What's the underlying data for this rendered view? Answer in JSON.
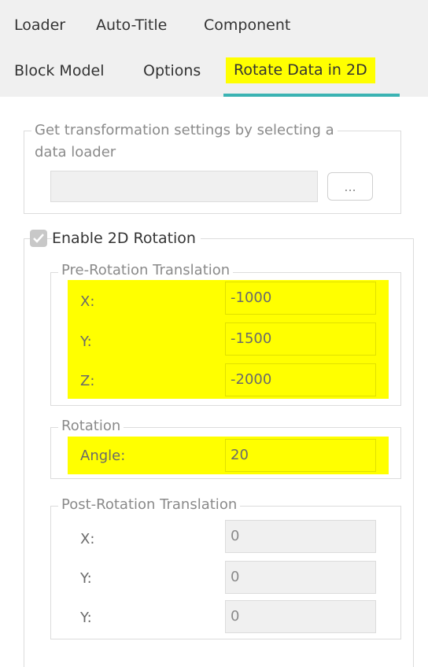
{
  "tabs": {
    "row1": [
      "Loader",
      "Auto-Title",
      "Component"
    ],
    "row2": [
      "Block Model",
      "Options"
    ],
    "active": "Rotate Data in 2D"
  },
  "data_loader_group": {
    "legend_line1": "Get transformation settings by selecting a",
    "legend_line2": "data loader",
    "path_value": "",
    "browse_label": "..."
  },
  "rotation_enable": {
    "label": "Enable 2D Rotation",
    "checked": true
  },
  "pre_rotation": {
    "legend": "Pre-Rotation Translation",
    "fields": [
      {
        "label": "X:",
        "value": "-1000"
      },
      {
        "label": "Y:",
        "value": "-1500"
      },
      {
        "label": "Z:",
        "value": "-2000"
      }
    ]
  },
  "rotation": {
    "legend": "Rotation",
    "angle_label": "Angle:",
    "angle_value": "20"
  },
  "post_rotation": {
    "legend": "Post-Rotation Translation",
    "fields": [
      {
        "label": "X:",
        "value": "0"
      },
      {
        "label": "Y:",
        "value": "0"
      },
      {
        "label": "Y:",
        "value": "0"
      }
    ]
  },
  "colors": {
    "highlight": "#ffff00",
    "tab_underline": "#3bb3b3",
    "tab_bar_bg": "#f0f0f0"
  }
}
